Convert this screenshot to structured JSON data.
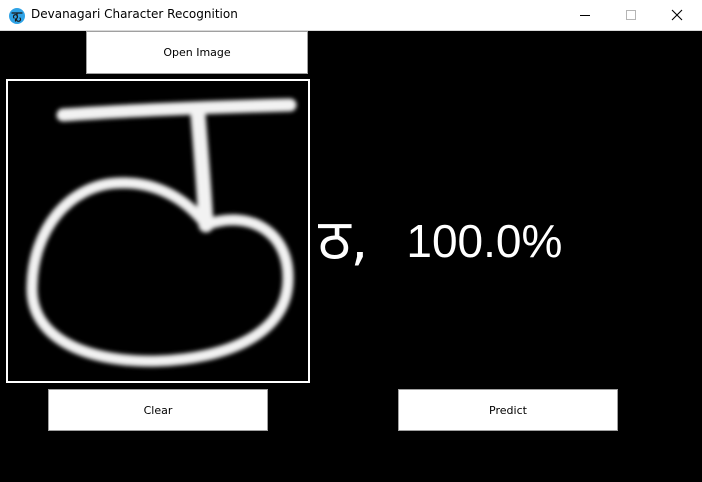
{
  "window": {
    "title": "Devanagari Character Recognition",
    "app_icon": "devanagari-ka-icon",
    "controls": [
      "minimize-icon",
      "maximize-icon",
      "close-icon"
    ]
  },
  "toolbar": {
    "open_label": "Open Image"
  },
  "canvas": {
    "drawn_character": "ठ"
  },
  "prediction": {
    "character": "ठ",
    "separator": ",",
    "confidence": "100.0%"
  },
  "actions": {
    "clear_label": "Clear",
    "predict_label": "Predict"
  },
  "colors": {
    "background": "#000000",
    "titlebar": "#ffffff",
    "text_on_dark": "#ffffff",
    "app_icon": "#2fa3e6",
    "button_border": "#a0a0a0"
  }
}
